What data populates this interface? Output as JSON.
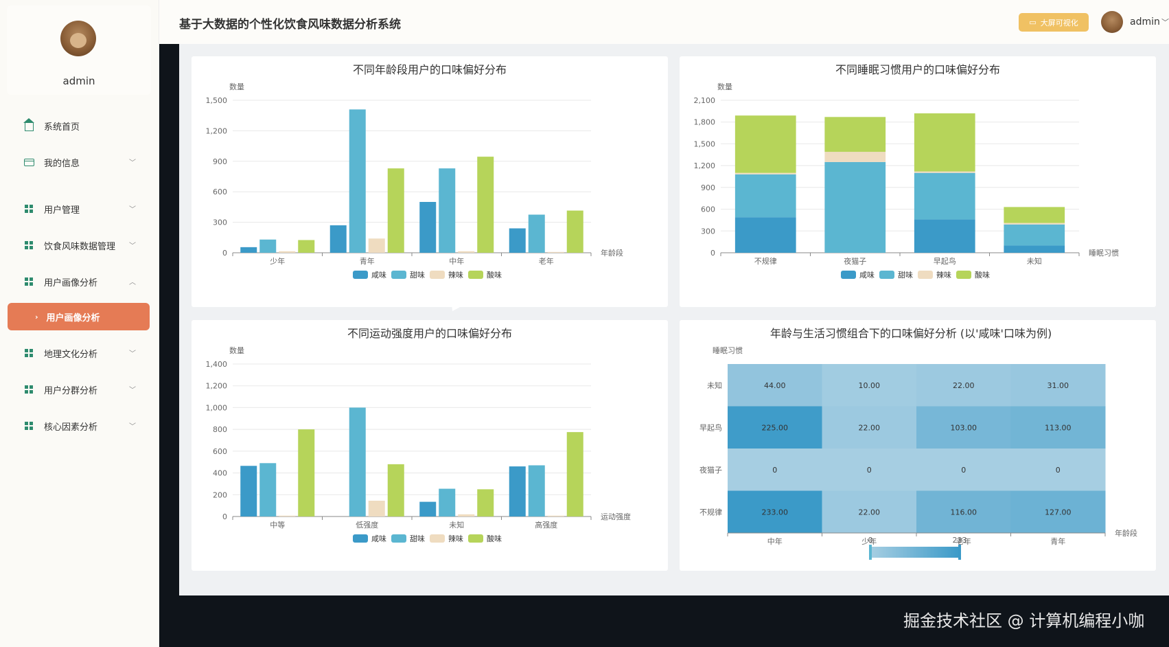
{
  "app": {
    "title": "基于大数据的个性化饮食风味数据分析系统",
    "user": "admin",
    "bigscreen_label": "大屏可视化"
  },
  "sidebar": {
    "profile_name": "admin",
    "items": [
      {
        "label": "系统首页",
        "icon": "home-icon"
      },
      {
        "label": "我的信息",
        "icon": "card-icon"
      },
      {
        "label": "用户管理",
        "icon": "grid-icon"
      },
      {
        "label": "饮食风味数据管理",
        "icon": "grid-icon"
      },
      {
        "label": "用户画像分析",
        "icon": "grid-icon"
      },
      {
        "label": "用户画像分析",
        "icon": "chevron-right-icon"
      },
      {
        "label": "地理文化分析",
        "icon": "grid-icon"
      },
      {
        "label": "用户分群分析",
        "icon": "grid-icon"
      },
      {
        "label": "核心因素分析",
        "icon": "grid-icon"
      }
    ]
  },
  "watermark": "掘金技术社区 @ 计算机编程小咖",
  "colors": {
    "salty": "#3b9ac8",
    "sweet": "#5bb6d1",
    "spicy": "#efdcc0",
    "sour": "#b6d45a",
    "accent": "#e57b55",
    "button": "#f0c163"
  },
  "chart_data": [
    {
      "type": "bar",
      "title": "不同年龄段用户的口味偏好分布",
      "ylabel": "数量",
      "xlabel": "年龄段",
      "ylim": [
        0,
        1500
      ],
      "yticks": [
        "0",
        "300",
        "600",
        "900",
        "1,200",
        "1,500"
      ],
      "categories": [
        "少年",
        "青年",
        "中年",
        "老年"
      ],
      "series": [
        {
          "name": "咸味",
          "values": [
            55,
            270,
            500,
            240
          ]
        },
        {
          "name": "甜味",
          "values": [
            130,
            1410,
            830,
            375
          ]
        },
        {
          "name": "辣味",
          "values": [
            15,
            140,
            15,
            8
          ]
        },
        {
          "name": "酸味",
          "values": [
            125,
            830,
            945,
            415
          ]
        }
      ],
      "legend": "bottom"
    },
    {
      "type": "bar",
      "stacked": true,
      "title": "不同睡眠习惯用户的口味偏好分布",
      "ylabel": "数量",
      "xlabel": "睡眠习惯",
      "ylim": [
        0,
        2100
      ],
      "yticks": [
        "0",
        "300",
        "600",
        "900",
        "1,200",
        "1,500",
        "1,800",
        "2,100"
      ],
      "categories": [
        "不规律",
        "夜猫子",
        "早起鸟",
        "未知"
      ],
      "series": [
        {
          "name": "咸味",
          "values": [
            490,
            0,
            460,
            100
          ]
        },
        {
          "name": "甜味",
          "values": [
            590,
            1250,
            640,
            290
          ]
        },
        {
          "name": "辣味",
          "values": [
            20,
            140,
            20,
            20
          ]
        },
        {
          "name": "酸味",
          "values": [
            790,
            480,
            800,
            220
          ]
        }
      ],
      "legend": "bottom"
    },
    {
      "type": "bar",
      "title": "不同运动强度用户的口味偏好分布",
      "ylabel": "数量",
      "xlabel": "运动强度",
      "ylim": [
        0,
        1400
      ],
      "yticks": [
        "0",
        "200",
        "400",
        "600",
        "800",
        "1,000",
        "1,200",
        "1,400"
      ],
      "categories": [
        "中等",
        "低强度",
        "未知",
        "高强度"
      ],
      "series": [
        {
          "name": "咸味",
          "values": [
            465,
            0,
            135,
            460
          ]
        },
        {
          "name": "甜味",
          "values": [
            490,
            1000,
            255,
            470
          ]
        },
        {
          "name": "辣味",
          "values": [
            8,
            145,
            20,
            8
          ]
        },
        {
          "name": "酸味",
          "values": [
            800,
            480,
            250,
            775
          ]
        }
      ],
      "legend": "bottom"
    },
    {
      "type": "heatmap",
      "title": "年龄与生活习惯组合下的口味偏好分析 (以'咸味'口味为例)",
      "ylabel": "睡眠习惯",
      "xlabel": "年龄段",
      "x": [
        "中年",
        "少年",
        "老年",
        "青年"
      ],
      "y": [
        "未知",
        "早起鸟",
        "夜猫子",
        "不规律"
      ],
      "values": [
        [
          "44.00",
          "10.00",
          "22.00",
          "31.00"
        ],
        [
          "225.00",
          "22.00",
          "103.00",
          "113.00"
        ],
        [
          "0",
          "0",
          "0",
          "0"
        ],
        [
          "233.00",
          "22.00",
          "116.00",
          "127.00"
        ]
      ],
      "visual_map": {
        "min": "0",
        "max": "233"
      }
    }
  ]
}
